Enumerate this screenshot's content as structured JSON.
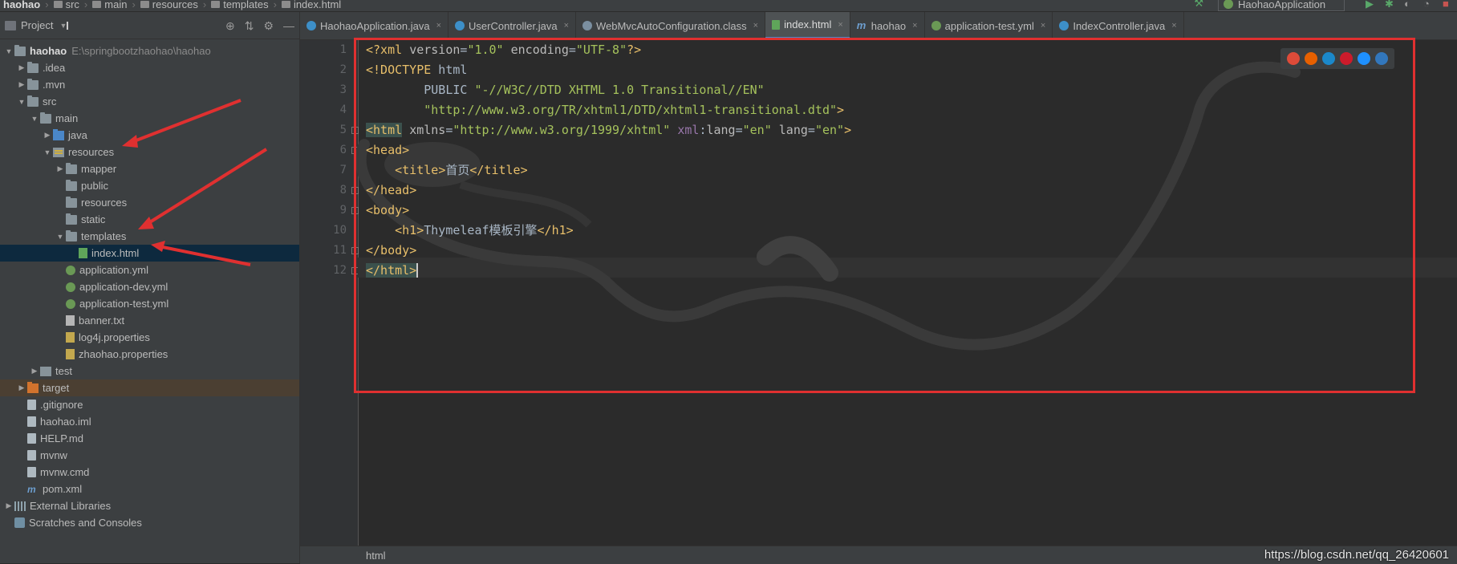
{
  "breadcrumb": [
    "haohao",
    "src",
    "main",
    "resources",
    "templates",
    "index.html"
  ],
  "run_config": "HaohaoApplication",
  "project_panel": {
    "title": "Project",
    "tree": [
      {
        "label": "haohao",
        "extra": "E:\\springbootzhaohao\\haohao",
        "depth": 0,
        "arrow": "▼",
        "icon": "folder",
        "bold": true
      },
      {
        "label": ".idea",
        "depth": 1,
        "arrow": "▶",
        "icon": "folder"
      },
      {
        "label": ".mvn",
        "depth": 1,
        "arrow": "▶",
        "icon": "folder"
      },
      {
        "label": "src",
        "depth": 1,
        "arrow": "▼",
        "icon": "folder"
      },
      {
        "label": "main",
        "depth": 2,
        "arrow": "▼",
        "icon": "folder"
      },
      {
        "label": "java",
        "depth": 3,
        "arrow": "▶",
        "icon": "folder-src"
      },
      {
        "label": "resources",
        "depth": 3,
        "arrow": "▼",
        "icon": "folder-res"
      },
      {
        "label": "mapper",
        "depth": 4,
        "arrow": "▶",
        "icon": "folder"
      },
      {
        "label": "public",
        "depth": 4,
        "arrow": "",
        "icon": "folder"
      },
      {
        "label": "resources",
        "depth": 4,
        "arrow": "",
        "icon": "folder"
      },
      {
        "label": "static",
        "depth": 4,
        "arrow": "",
        "icon": "folder"
      },
      {
        "label": "templates",
        "depth": 4,
        "arrow": "▼",
        "icon": "folder"
      },
      {
        "label": "index.html",
        "depth": 5,
        "arrow": "",
        "icon": "file-html",
        "selected": true
      },
      {
        "label": "application.yml",
        "depth": 4,
        "arrow": "",
        "icon": "file-yml"
      },
      {
        "label": "application-dev.yml",
        "depth": 4,
        "arrow": "",
        "icon": "file-yml"
      },
      {
        "label": "application-test.yml",
        "depth": 4,
        "arrow": "",
        "icon": "file-yml"
      },
      {
        "label": "banner.txt",
        "depth": 4,
        "arrow": "",
        "icon": "file-txt"
      },
      {
        "label": "log4j.properties",
        "depth": 4,
        "arrow": "",
        "icon": "file-prop"
      },
      {
        "label": "zhaohao.properties",
        "depth": 4,
        "arrow": "",
        "icon": "file-prop"
      },
      {
        "label": "test",
        "depth": 2,
        "arrow": "▶",
        "icon": "folder-test"
      },
      {
        "label": "target",
        "depth": 1,
        "arrow": "▶",
        "icon": "folder-orange",
        "target": true
      },
      {
        "label": ".gitignore",
        "depth": 1,
        "arrow": "",
        "icon": "file"
      },
      {
        "label": "haohao.iml",
        "depth": 1,
        "arrow": "",
        "icon": "file"
      },
      {
        "label": "HELP.md",
        "depth": 1,
        "arrow": "",
        "icon": "file"
      },
      {
        "label": "mvnw",
        "depth": 1,
        "arrow": "",
        "icon": "file"
      },
      {
        "label": "mvnw.cmd",
        "depth": 1,
        "arrow": "",
        "icon": "file"
      },
      {
        "label": "pom.xml",
        "depth": 1,
        "arrow": "",
        "icon": "file-m"
      },
      {
        "label": "External Libraries",
        "depth": 0,
        "arrow": "▶",
        "icon": "lib"
      },
      {
        "label": "Scratches and Consoles",
        "depth": 0,
        "arrow": "",
        "icon": "scratch"
      }
    ]
  },
  "tabs": [
    {
      "label": "HaohaoApplication.java",
      "icon": "java",
      "active": false
    },
    {
      "label": "UserController.java",
      "icon": "java",
      "active": false
    },
    {
      "label": "WebMvcAutoConfiguration.class",
      "icon": "cls",
      "active": false
    },
    {
      "label": "index.html",
      "icon": "html",
      "active": true
    },
    {
      "label": "haohao",
      "icon": "m",
      "active": false
    },
    {
      "label": "application-test.yml",
      "icon": "yml",
      "active": false
    },
    {
      "label": "IndexController.java",
      "icon": "java",
      "active": false
    }
  ],
  "code": {
    "line_numbers": [
      "1",
      "2",
      "3",
      "4",
      "5",
      "6",
      "7",
      "8",
      "9",
      "10",
      "11",
      "12"
    ],
    "lines": [
      "<?xml version=\"1.0\" encoding=\"UTF-8\"?>",
      "<!DOCTYPE html",
      "        PUBLIC \"-//W3C//DTD XHTML 1.0 Transitional//EN\"",
      "        \"http://www.w3.org/TR/xhtml1/DTD/xhtml1-transitional.dtd\">",
      "<html xmlns=\"http://www.w3.org/1999/xhtml\" xml:lang=\"en\" lang=\"en\">",
      "<head>",
      "    <title>首页</title>",
      "</head>",
      "<body>",
      "    <h1>Thymeleaf模板引擎</h1>",
      "</body>",
      "</html>"
    ]
  },
  "status": {
    "context": "html",
    "watermark": "https://blog.csdn.net/qq_26420601"
  },
  "browser_icons": [
    "chrome-icon",
    "firefox-icon",
    "safari-icon",
    "opera-icon",
    "ie-icon",
    "edge-icon"
  ]
}
